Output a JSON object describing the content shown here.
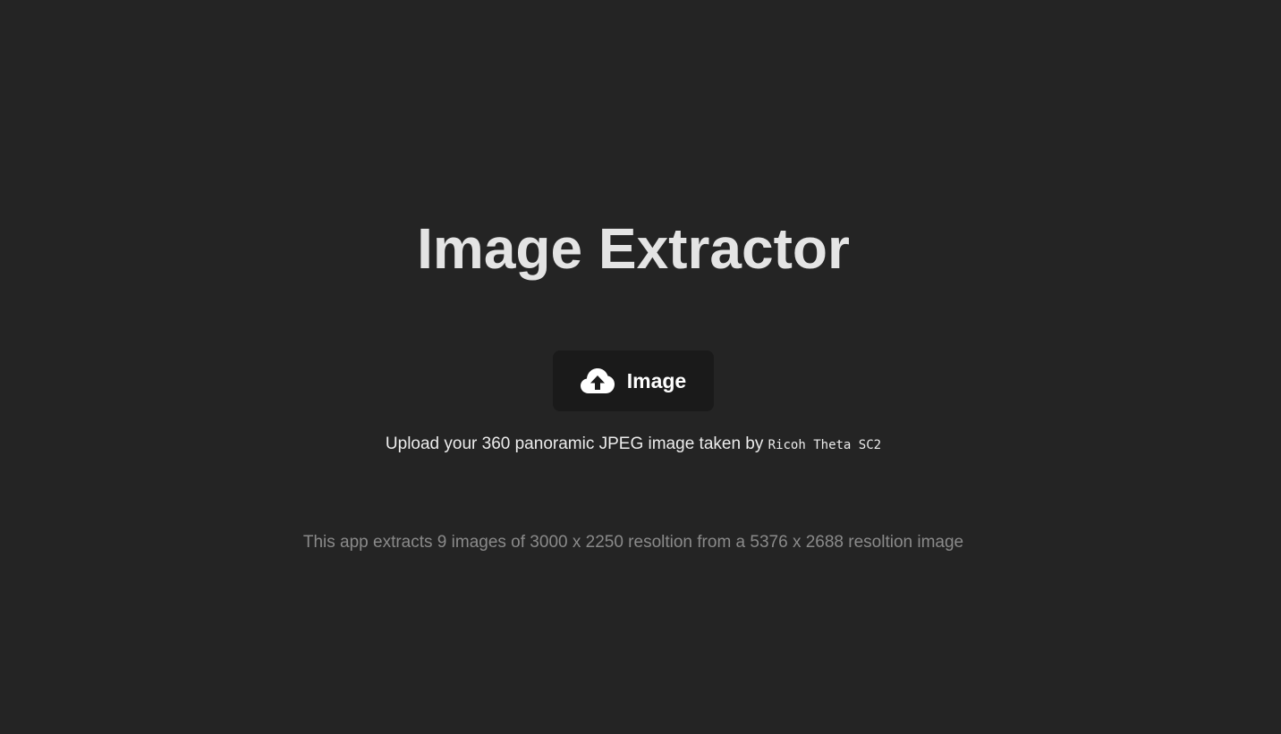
{
  "header": {
    "title": "Image Extractor"
  },
  "upload": {
    "button_label": "Image",
    "icon": "cloud-upload-icon"
  },
  "instructions": {
    "prefix": "Upload your 360 panoramic JPEG image taken by ",
    "camera_model": "Ricoh Theta SC2"
  },
  "footer": {
    "info_text": "This app extracts 9 images of 3000 x 2250 resoltion from a 5376 x 2688 resoltion image"
  },
  "colors": {
    "background": "#242424",
    "button_background": "#1a1a1a",
    "title": "#e4e4e4",
    "info_text": "#8a8a8a"
  }
}
